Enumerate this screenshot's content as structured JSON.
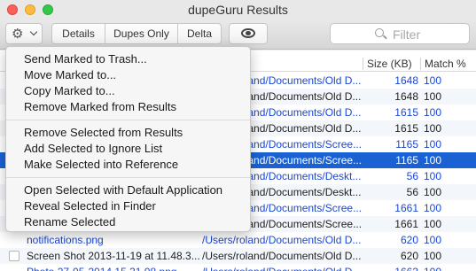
{
  "window": {
    "title": "dupeGuru Results"
  },
  "toolbar": {
    "actions_icon": "gear-icon",
    "details_label": "Details",
    "dupes_only_label": "Dupes Only",
    "delta_label": "Delta",
    "quicklook_icon": "eye-icon",
    "search_placeholder": "Filter"
  },
  "table": {
    "columns": {
      "size": "Size (KB)",
      "match": "Match %"
    },
    "rows": [
      {
        "name": "",
        "path": "/Users/roland/Documents/Old D...",
        "size": "1648",
        "match": "100",
        "ref": true,
        "checkbox": false
      },
      {
        "name": "",
        "path": "/Users/roland/Documents/Old D...",
        "size": "1648",
        "match": "100",
        "ref": false,
        "checkbox": false
      },
      {
        "name": "",
        "path": "/Users/roland/Documents/Old D...",
        "size": "1615",
        "match": "100",
        "ref": true,
        "checkbox": false
      },
      {
        "name": "",
        "path": "/Users/roland/Documents/Old D...",
        "size": "1615",
        "match": "100",
        "ref": false,
        "checkbox": false
      },
      {
        "name": "",
        "path": "/Users/roland/Documents/Scree...",
        "size": "1165",
        "match": "100",
        "ref": true,
        "checkbox": false
      },
      {
        "name": "",
        "path": "/Users/roland/Documents/Scree...",
        "size": "1165",
        "match": "100",
        "ref": false,
        "checkbox": false,
        "selected": true
      },
      {
        "name": "",
        "path": "/Users/roland/Documents/Deskt...",
        "size": "56",
        "match": "100",
        "ref": true,
        "checkbox": false
      },
      {
        "name": "",
        "path": "/Users/roland/Documents/Deskt...",
        "size": "56",
        "match": "100",
        "ref": false,
        "checkbox": false
      },
      {
        "name": "",
        "path": "/Users/roland/Documents/Scree...",
        "size": "1661",
        "match": "100",
        "ref": true,
        "checkbox": false
      },
      {
        "name": "",
        "path": "/Users/roland/Documents/Scree...",
        "size": "1661",
        "match": "100",
        "ref": false,
        "checkbox": false
      },
      {
        "name": "notifications.png",
        "path": "/Users/roland/Documents/Old D...",
        "size": "620",
        "match": "100",
        "ref": true,
        "checkbox": false
      },
      {
        "name": "Screen Shot 2013-11-19 at 11.48.3...",
        "path": "/Users/roland/Documents/Old D...",
        "size": "620",
        "match": "100",
        "ref": false,
        "checkbox": true
      },
      {
        "name": "Photo 27-05-2014 15 31 08.png",
        "path": "/Users/roland/Documents/Old D...",
        "size": "1663",
        "match": "100",
        "ref": true,
        "checkbox": false
      }
    ]
  },
  "menu": {
    "items": [
      "Send Marked to Trash...",
      "Move Marked to...",
      "Copy Marked to...",
      "Remove Marked from Results",
      "Remove Selected from Results",
      "Add Selected to Ignore List",
      "Make Selected into Reference",
      "Open Selected with Default Application",
      "Reveal Selected in Finder",
      "Rename Selected"
    ]
  },
  "colors": {
    "selection": "#1a62d4",
    "reference_text": "#1b47d6"
  }
}
